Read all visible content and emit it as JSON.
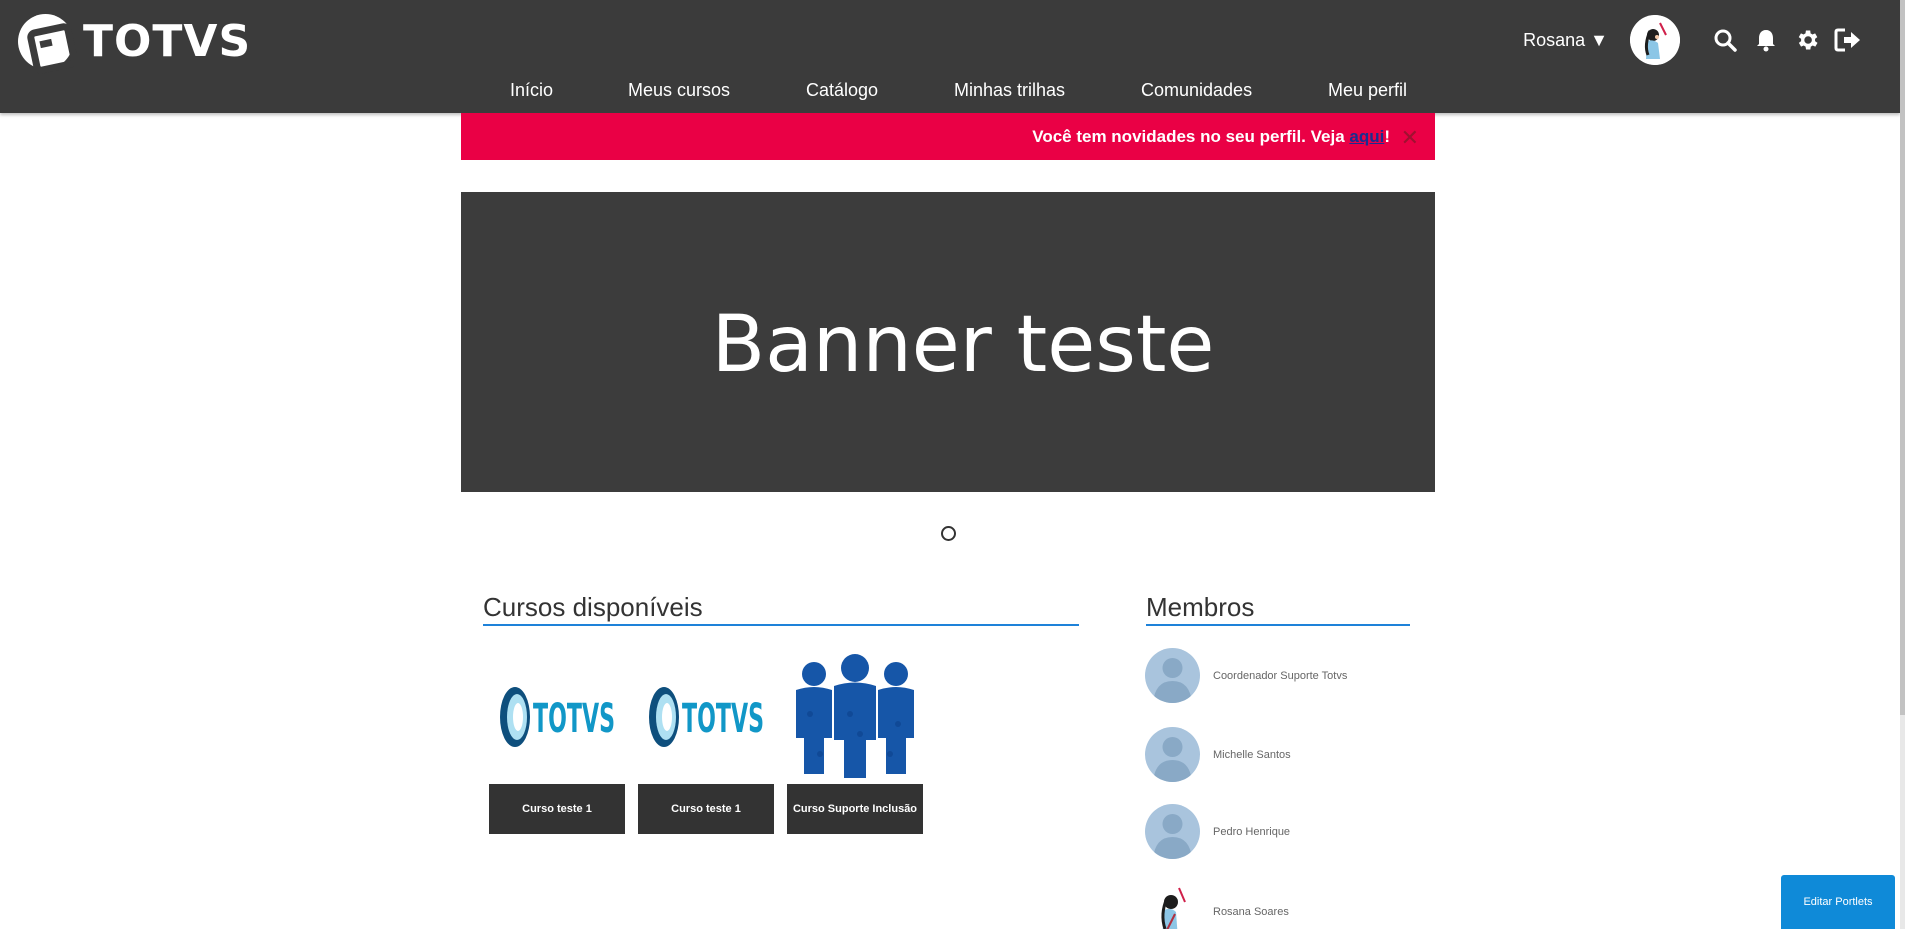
{
  "header": {
    "brand": "TOTVS",
    "user_name": "Rosana ▼",
    "icons": [
      "search-icon",
      "bell-icon",
      "gear-icon",
      "logout-icon"
    ]
  },
  "nav": {
    "items": [
      {
        "label": "Início"
      },
      {
        "label": "Meus cursos"
      },
      {
        "label": "Catálogo"
      },
      {
        "label": "Minhas trilhas"
      },
      {
        "label": "Comunidades"
      },
      {
        "label": "Meu perfil"
      }
    ]
  },
  "alert": {
    "text": "Você tem novidades no seu perfil. Veja ",
    "link": "aqui",
    "suffix": "!",
    "close": "✕",
    "color": "#ea0045"
  },
  "banner": {
    "title": "Banner teste"
  },
  "courses": {
    "title": "Cursos disponíveis",
    "items": [
      {
        "label": "Curso teste 1",
        "image_text": "TOTVS"
      },
      {
        "label": "Curso teste 1",
        "image_text": "TOTVS"
      },
      {
        "label": "Curso Suporte Inclusão"
      }
    ]
  },
  "members": {
    "title": "Membros",
    "items": [
      {
        "name": "Coordenador Suporte Totvs"
      },
      {
        "name": "Michelle Santos"
      },
      {
        "name": "Pedro Henrique"
      },
      {
        "name": "Rosana Soares"
      }
    ]
  },
  "edit_portlets": "Editar Portlets",
  "colors": {
    "accent": "#1e82d9",
    "header_bg": "#3b3b3b",
    "alert": "#ea0045",
    "button": "#0f8ad8"
  }
}
